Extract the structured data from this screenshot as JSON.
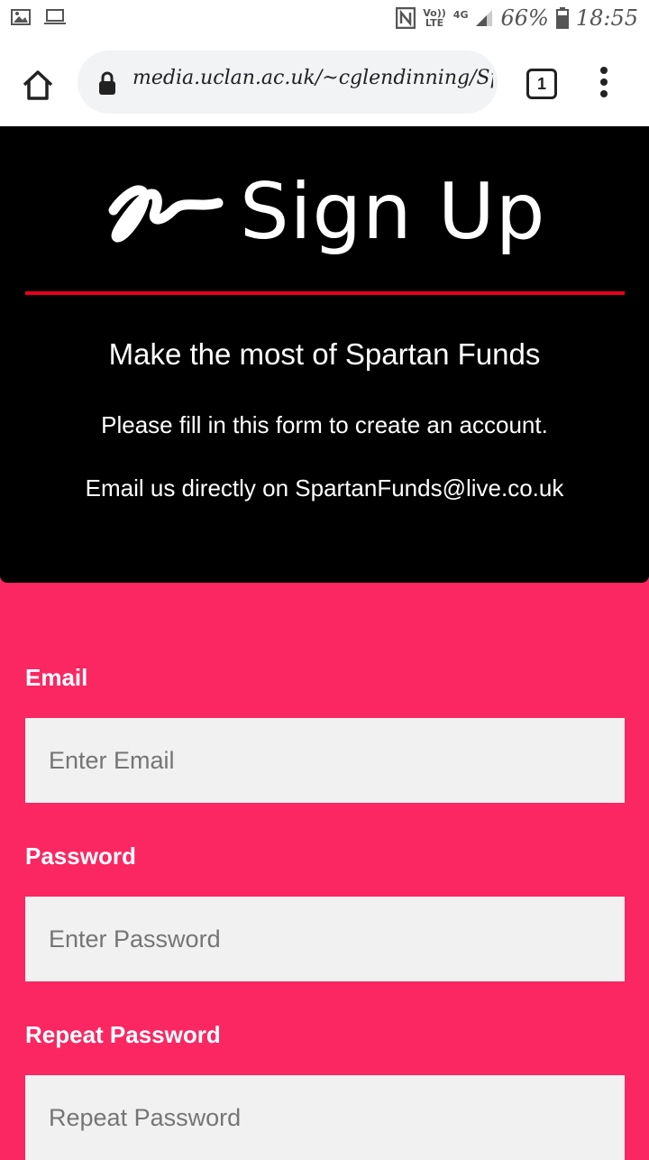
{
  "status_bar": {
    "battery": "66%",
    "time": "18:55",
    "volte_top": "Vo))",
    "volte_bottom": "LTE",
    "network": "4G"
  },
  "browser": {
    "url": "media.uclan.ac.uk/~cglendinning/Spa",
    "tab_count": "1"
  },
  "header": {
    "title": "Sign Up",
    "subtitle": "Make the most of Spartan Funds",
    "intro": "Please fill in this form to create an account.",
    "contact": "Email us directly on SpartanFunds@live.co.uk",
    "accent_color": "#e8001c"
  },
  "form": {
    "email_label": "Email",
    "email_placeholder": "Enter Email",
    "password_label": "Password",
    "password_placeholder": "Enter Password",
    "repeat_label": "Repeat Password",
    "repeat_placeholder": "Repeat Password",
    "background_color": "#fa2762"
  }
}
